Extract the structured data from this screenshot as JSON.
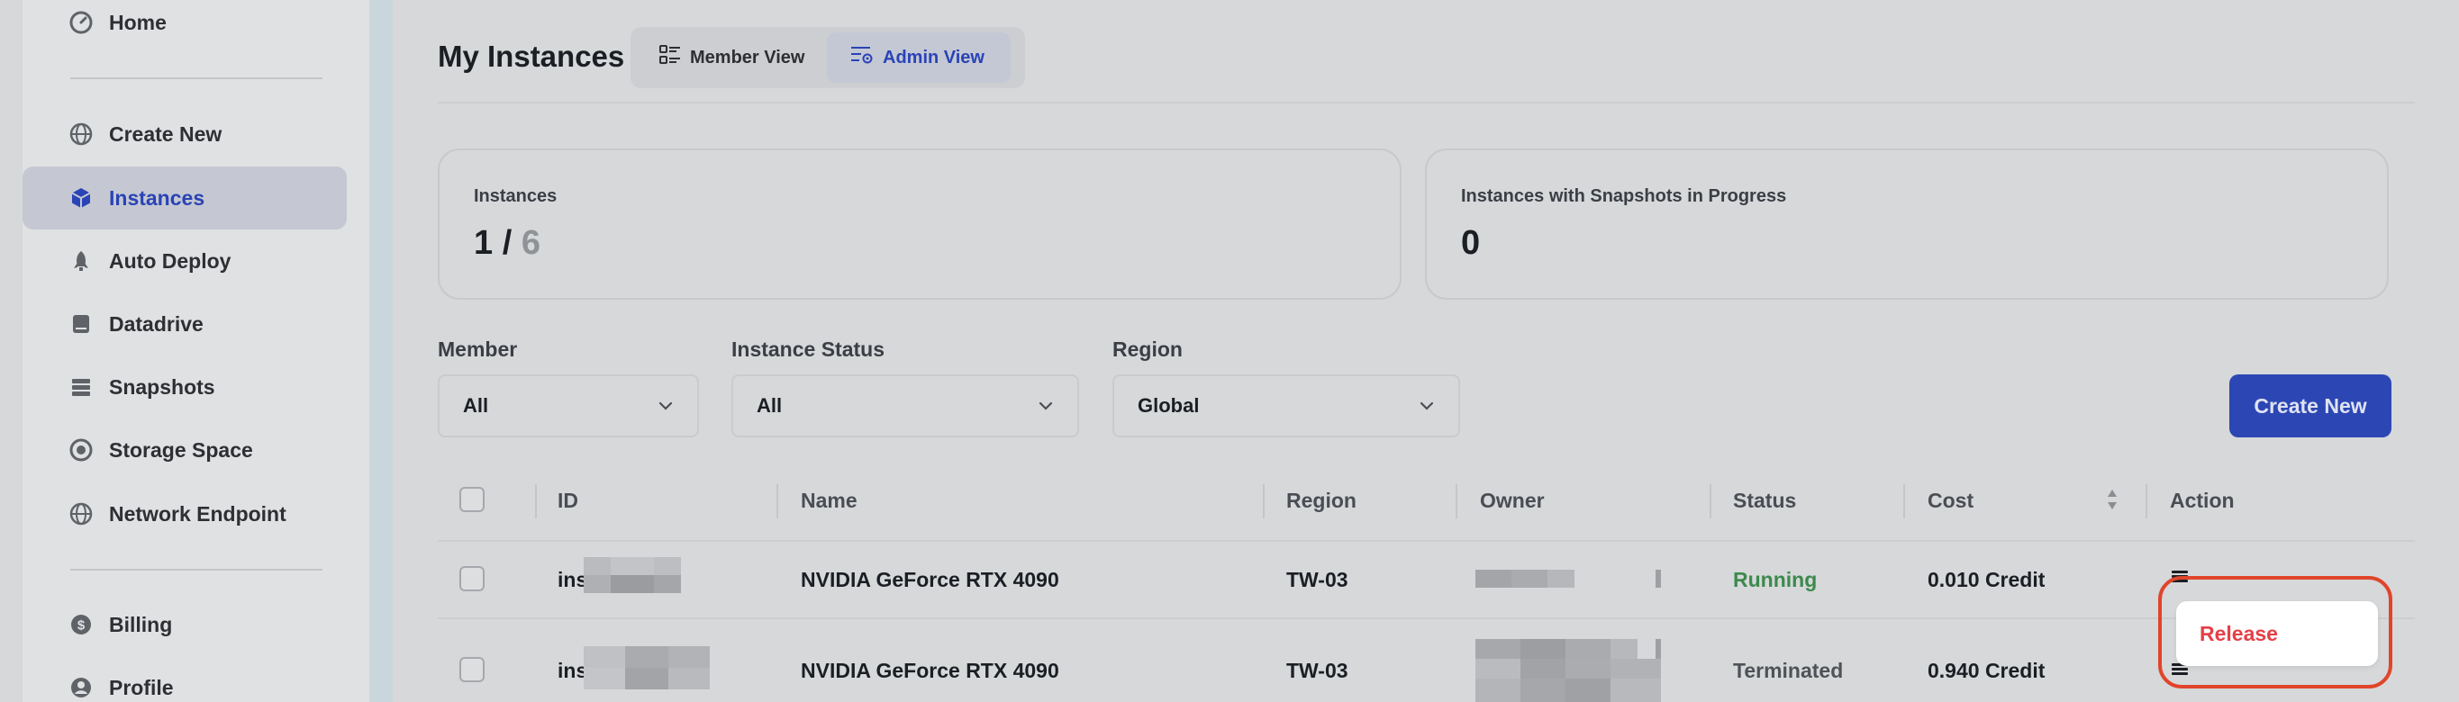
{
  "sidebar": {
    "items": [
      {
        "label": "Home",
        "icon": "gauge-icon"
      },
      {
        "label": "Create New",
        "icon": "globe-icon"
      },
      {
        "label": "Instances",
        "icon": "cube-icon",
        "active": true
      },
      {
        "label": "Auto Deploy",
        "icon": "rocket-icon"
      },
      {
        "label": "Datadrive",
        "icon": "drive-icon"
      },
      {
        "label": "Snapshots",
        "icon": "stack-icon"
      },
      {
        "label": "Storage Space",
        "icon": "disc-icon"
      },
      {
        "label": "Network Endpoint",
        "icon": "network-icon"
      },
      {
        "label": "Billing",
        "icon": "dollar-icon"
      },
      {
        "label": "Profile",
        "icon": "user-icon"
      }
    ]
  },
  "header": {
    "title": "My Instances",
    "views": [
      {
        "label": "Member View",
        "active": false
      },
      {
        "label": "Admin View",
        "active": true
      }
    ]
  },
  "stats": {
    "instances": {
      "label": "Instances",
      "current": "1",
      "sep": " / ",
      "total": "6"
    },
    "snapshots": {
      "label": "Instances with Snapshots in Progress",
      "value": "0"
    }
  },
  "filters": {
    "member": {
      "label": "Member",
      "value": "All"
    },
    "status": {
      "label": "Instance Status",
      "value": "All"
    },
    "region": {
      "label": "Region",
      "value": "Global"
    }
  },
  "create_button": "Create New",
  "table": {
    "headers": {
      "id": "ID",
      "name": "Name",
      "region": "Region",
      "owner": "Owner",
      "status": "Status",
      "cost": "Cost",
      "action": "Action"
    },
    "rows": [
      {
        "id": "ins",
        "name": "NVIDIA GeForce RTX 4090",
        "region": "TW-03",
        "status": "Running",
        "cost": "0.010 Credit"
      },
      {
        "id": "ins",
        "name": "NVIDIA GeForce RTX 4090",
        "region": "TW-03",
        "status": "Terminated",
        "cost": "0.940 Credit"
      }
    ]
  },
  "action_menu": {
    "items": [
      "Release"
    ]
  },
  "colors": {
    "accent": "#2c47b4",
    "running": "#3c8a4c",
    "danger": "#e53f47",
    "highlight": "#e0452b"
  }
}
